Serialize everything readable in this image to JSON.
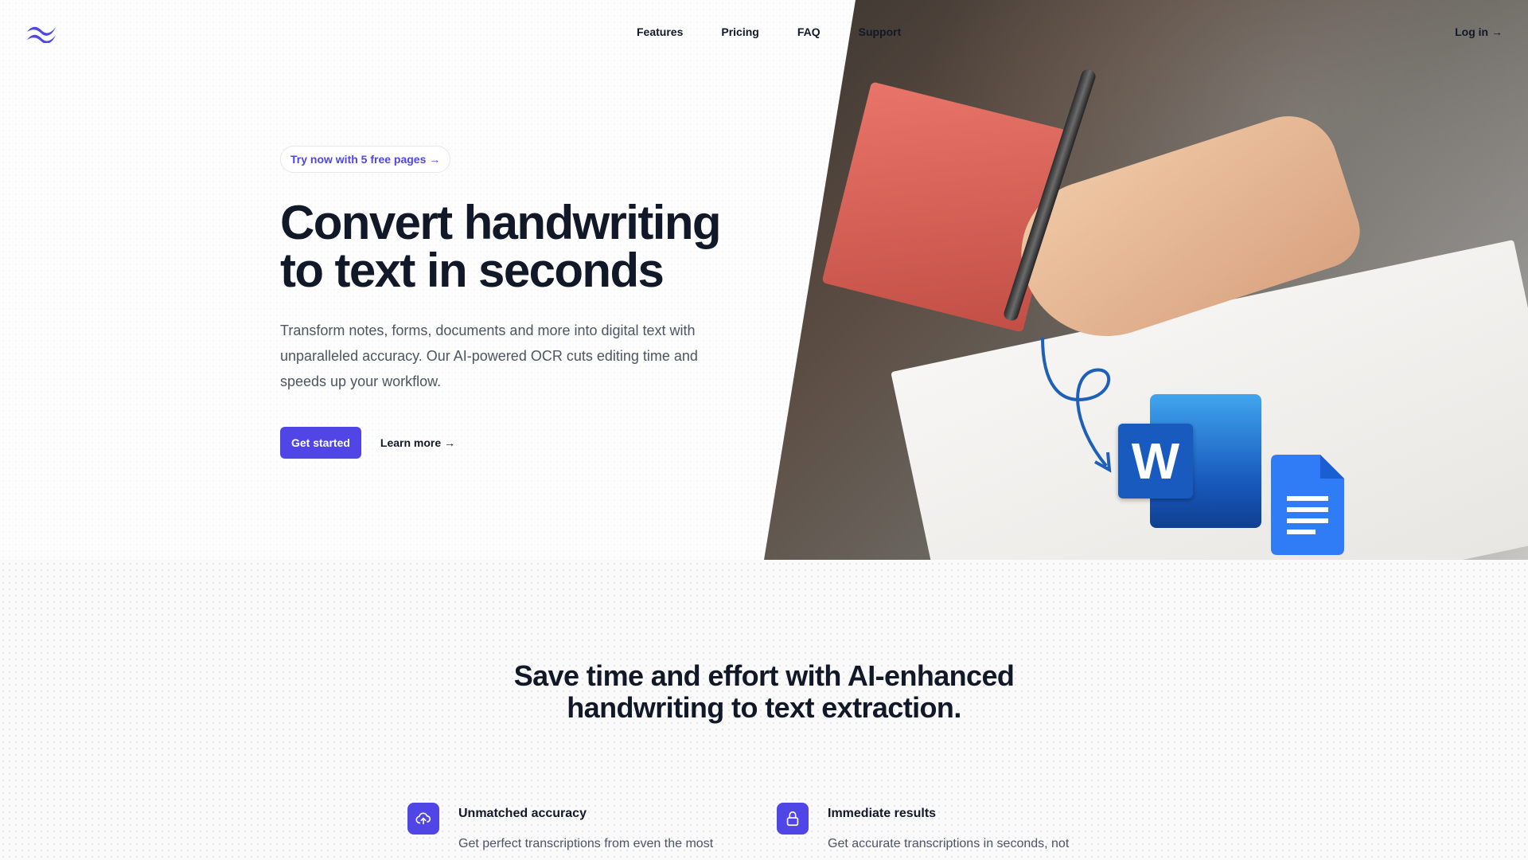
{
  "nav": {
    "logo_name": "wave-logo-icon",
    "links": [
      "Features",
      "Pricing",
      "FAQ",
      "Support"
    ],
    "login_label": "Log in →"
  },
  "hero": {
    "pill_label": "Try now with 5 free pages →",
    "title_line1": "Convert handwriting",
    "title_line2": "to text in seconds",
    "description": "Transform notes, forms, documents and more into digital text with unparalleled accuracy. Our AI-powered OCR cuts editing time and speeds up your workflow.",
    "primary_cta": "Get started",
    "secondary_cta": "Learn more →",
    "image_icons": [
      "word-icon",
      "google-docs-icon"
    ]
  },
  "section": {
    "title_line1": "Save time and effort with AI-enhanced",
    "title_line2": "handwriting to text extraction."
  },
  "features": [
    {
      "icon": "cloud-upload-icon",
      "title": "Unmatched accuracy",
      "description": "Get perfect transcriptions from even the most"
    },
    {
      "icon": "lock-icon",
      "title": "Immediate results",
      "description": "Get accurate transcriptions in seconds, not hours."
    }
  ],
  "colors": {
    "accent": "#4f46e5",
    "heading": "#111827",
    "body_text": "#4b5563"
  }
}
